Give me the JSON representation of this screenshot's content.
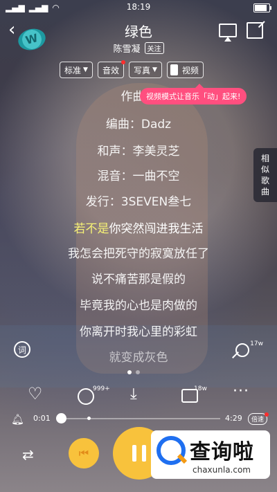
{
  "status_bar": {
    "time": "18:19",
    "battery_level": 0.85
  },
  "header": {
    "title": "绿色",
    "artist": "陈雪凝",
    "follow_label": "关注"
  },
  "chips": {
    "quality_label": "标准",
    "effect_label": "音效",
    "photo_label": "写真",
    "video_label": "视频"
  },
  "tooltip_text": "视频模式让音乐「动」起来!",
  "side_tab_label": [
    "相",
    "似",
    "歌",
    "曲"
  ],
  "lyrics": {
    "lines": [
      "作曲：",
      "编曲：Dadz",
      "和声：李美灵芝",
      "混音：一曲不空",
      "发行：3SEVEN叁七",
      "",
      "我怎会把死守的寂寞放任了",
      "说不痛苦那是假的",
      "毕竟我的心也是肉做的",
      "你离开时我心里的彩虹",
      "就变成灰色"
    ],
    "current_sung": "若不是",
    "current_rest": "你突然闯进我生活"
  },
  "lyrics_toggle_label": "词",
  "mic_count": "17w",
  "actions": {
    "comment_count": "999+",
    "message_count": "18w"
  },
  "progress": {
    "current": "0:01",
    "total": "4:29",
    "fraction": 0.004,
    "speed_label": "倍速"
  },
  "watermark": {
    "text": "查询啦",
    "url": "chaxunla.com"
  },
  "colors": {
    "accent_yellow": "#f8c23c",
    "highlight_lyric": "#f6f276",
    "tooltip_pink": "#ff4f7f"
  }
}
